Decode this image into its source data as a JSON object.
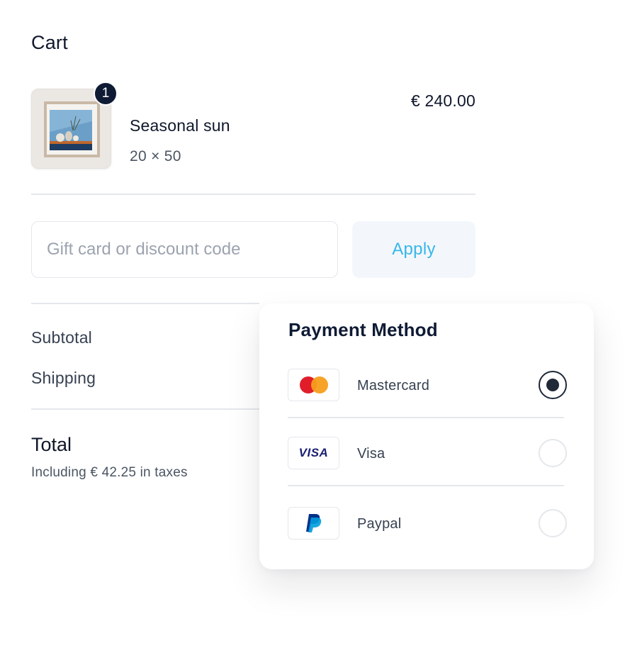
{
  "cart": {
    "title": "Cart",
    "item": {
      "name": "Seasonal sun",
      "size": "20 × 50",
      "price": "€ 240.00",
      "quantity": "1"
    }
  },
  "discount": {
    "placeholder": "Gift card or discount code",
    "value": "",
    "apply_label": "Apply"
  },
  "summary": {
    "subtotal_label": "Subtotal",
    "shipping_label": "Shipping",
    "total_label": "Total",
    "tax_note": "Including € 42.25 in taxes"
  },
  "payment": {
    "title": "Payment Method",
    "methods": [
      {
        "label": "Mastercard",
        "icon": "mastercard-icon",
        "selected": true
      },
      {
        "label": "Visa",
        "icon": "visa-icon",
        "logo_text": "VISA",
        "selected": false
      },
      {
        "label": "Paypal",
        "icon": "paypal-icon",
        "selected": false
      }
    ]
  },
  "colors": {
    "accent": "#38b6e9",
    "badge": "#0f1b34",
    "apply_bg": "#f3f7fc",
    "mastercard_red": "#e11d2a",
    "mastercard_orange": "#f79e1b",
    "visa_blue": "#1a1f71",
    "paypal_dark": "#003087",
    "paypal_light": "#009cde"
  }
}
